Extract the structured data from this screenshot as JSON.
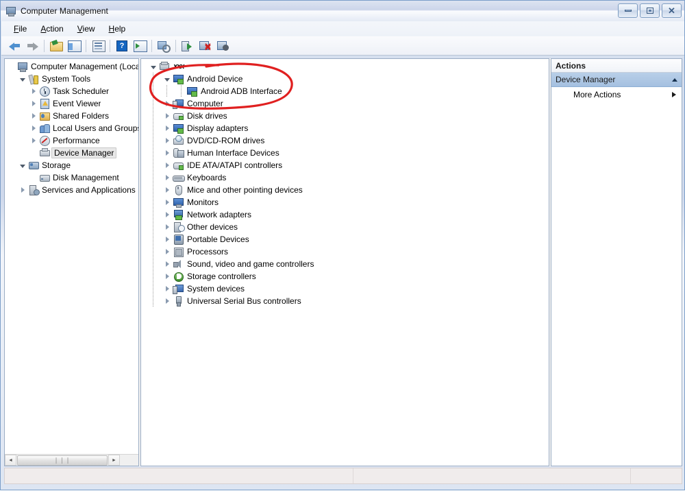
{
  "window": {
    "title": "Computer Management",
    "icon": "computer-management-icon",
    "buttons": {
      "minimize": "Minimize",
      "maximize": "Maximize",
      "close": "Close"
    }
  },
  "menubar": {
    "items": [
      {
        "label": "File",
        "accel": "F"
      },
      {
        "label": "Action",
        "accel": "A"
      },
      {
        "label": "View",
        "accel": "V"
      },
      {
        "label": "Help",
        "accel": "H"
      }
    ]
  },
  "toolbar": {
    "buttons": [
      {
        "name": "back-button",
        "icon": "back-arrow-icon",
        "label": "Back"
      },
      {
        "name": "forward-button",
        "icon": "forward-arrow-icon",
        "label": "Forward"
      },
      {
        "name": "up-one-level-button",
        "icon": "folder-up-icon",
        "label": "Up One Level"
      },
      {
        "name": "show-hide-tree-button",
        "icon": "console-tree-icon",
        "label": "Show/Hide Console Tree"
      },
      {
        "name": "properties-button",
        "icon": "properties-icon",
        "label": "Properties"
      },
      {
        "name": "help-button",
        "icon": "help-question-icon",
        "label": "Help"
      },
      {
        "name": "show-action-pane-button",
        "icon": "action-pane-icon",
        "label": "Show/Hide Action Pane"
      },
      {
        "name": "scan-hardware-button",
        "icon": "scan-hardware-icon",
        "label": "Scan for hardware changes"
      },
      {
        "name": "update-driver-button",
        "icon": "update-driver-icon",
        "label": "Update Driver Software"
      },
      {
        "name": "uninstall-button",
        "icon": "uninstall-device-icon",
        "label": "Uninstall"
      },
      {
        "name": "disable-button",
        "icon": "disable-device-icon",
        "label": "Disable"
      }
    ]
  },
  "console_tree": {
    "nodes": [
      {
        "label": "Computer Management (Local",
        "indent": 0,
        "expander": "none",
        "icon": "computer-management-icon",
        "icon_class": "ic-cm",
        "selected": false
      },
      {
        "label": "System Tools",
        "indent": 1,
        "expander": "open",
        "icon": "system-tools-icon",
        "icon_class": "ic-tools",
        "selected": false
      },
      {
        "label": "Task Scheduler",
        "indent": 2,
        "expander": "closed",
        "icon": "task-scheduler-icon",
        "icon_class": "ic-clock",
        "selected": false
      },
      {
        "label": "Event Viewer",
        "indent": 2,
        "expander": "closed",
        "icon": "event-viewer-icon",
        "icon_class": "ic-event",
        "selected": false
      },
      {
        "label": "Shared Folders",
        "indent": 2,
        "expander": "closed",
        "icon": "shared-folders-icon",
        "icon_class": "ic-shared",
        "selected": false
      },
      {
        "label": "Local Users and Groups",
        "indent": 2,
        "expander": "closed",
        "icon": "local-users-icon",
        "icon_class": "ic-users",
        "selected": false
      },
      {
        "label": "Performance",
        "indent": 2,
        "expander": "closed",
        "icon": "performance-icon",
        "icon_class": "ic-perf",
        "selected": false
      },
      {
        "label": "Device Manager",
        "indent": 2,
        "expander": "none",
        "icon": "device-manager-icon",
        "icon_class": "ic-devmgr",
        "selected": true
      },
      {
        "label": "Storage",
        "indent": 1,
        "expander": "open",
        "icon": "storage-icon",
        "icon_class": "ic-storage",
        "selected": false
      },
      {
        "label": "Disk Management",
        "indent": 2,
        "expander": "none",
        "icon": "disk-management-icon",
        "icon_class": "ic-disk",
        "selected": false
      },
      {
        "label": "Services and Applications",
        "indent": 1,
        "expander": "closed",
        "icon": "services-apps-icon",
        "icon_class": "ic-svc",
        "selected": false
      }
    ],
    "hscrollbar": {
      "left_arrow": "◄",
      "right_arrow": "►",
      "grip": "❘❘❘"
    }
  },
  "device_tree": {
    "nodes": [
      {
        "label": "xxx",
        "indent": 0,
        "expander": "open",
        "icon": "computer-root-icon",
        "icon_class": "ic-root",
        "handwritten": true
      },
      {
        "label": "Android Device",
        "indent": 1,
        "expander": "open",
        "icon": "android-device-icon",
        "icon_class": "ic-mon",
        "handwritten": false
      },
      {
        "label": "Android ADB Interface",
        "indent": 2,
        "expander": "none",
        "icon": "android-adb-icon",
        "icon_class": "ic-mon",
        "handwritten": false
      },
      {
        "label": "Computer",
        "indent": 1,
        "expander": "closed",
        "icon": "computer-icon",
        "icon_class": "ic-comp",
        "handwritten": false
      },
      {
        "label": "Disk drives",
        "indent": 1,
        "expander": "closed",
        "icon": "disk-drives-icon",
        "icon_class": "ic-drive",
        "handwritten": false
      },
      {
        "label": "Display adapters",
        "indent": 1,
        "expander": "closed",
        "icon": "display-adapters-icon",
        "icon_class": "ic-mon",
        "handwritten": false
      },
      {
        "label": "DVD/CD-ROM drives",
        "indent": 1,
        "expander": "closed",
        "icon": "dvd-cdrom-icon",
        "icon_class": "ic-dvd",
        "handwritten": false
      },
      {
        "label": "Human Interface Devices",
        "indent": 1,
        "expander": "closed",
        "icon": "hid-icon",
        "icon_class": "ic-hid",
        "handwritten": false
      },
      {
        "label": "IDE ATA/ATAPI controllers",
        "indent": 1,
        "expander": "closed",
        "icon": "ide-controllers-icon",
        "icon_class": "ic-ide",
        "handwritten": false
      },
      {
        "label": "Keyboards",
        "indent": 1,
        "expander": "closed",
        "icon": "keyboard-icon",
        "icon_class": "ic-kbd",
        "handwritten": false
      },
      {
        "label": "Mice and other pointing devices",
        "indent": 1,
        "expander": "closed",
        "icon": "mouse-icon",
        "icon_class": "ic-mouse",
        "handwritten": false
      },
      {
        "label": "Monitors",
        "indent": 1,
        "expander": "closed",
        "icon": "monitor-icon",
        "icon_class": "ic-monitor",
        "handwritten": false
      },
      {
        "label": "Network adapters",
        "indent": 1,
        "expander": "closed",
        "icon": "network-adapter-icon",
        "icon_class": "ic-net",
        "handwritten": false
      },
      {
        "label": "Other devices",
        "indent": 1,
        "expander": "closed",
        "icon": "other-devices-icon",
        "icon_class": "ic-other",
        "handwritten": false
      },
      {
        "label": "Portable Devices",
        "indent": 1,
        "expander": "closed",
        "icon": "portable-devices-icon",
        "icon_class": "ic-port",
        "handwritten": false
      },
      {
        "label": "Processors",
        "indent": 1,
        "expander": "closed",
        "icon": "processor-icon",
        "icon_class": "ic-cpu",
        "handwritten": false
      },
      {
        "label": "Sound, video and game controllers",
        "indent": 1,
        "expander": "closed",
        "icon": "sound-controllers-icon",
        "icon_class": "ic-snd",
        "handwritten": false
      },
      {
        "label": "Storage controllers",
        "indent": 1,
        "expander": "closed",
        "icon": "storage-controllers-icon",
        "icon_class": "ic-stc",
        "handwritten": false
      },
      {
        "label": "System devices",
        "indent": 1,
        "expander": "closed",
        "icon": "system-devices-icon",
        "icon_class": "ic-sys",
        "handwritten": false
      },
      {
        "label": "Universal Serial Bus controllers",
        "indent": 1,
        "expander": "closed",
        "icon": "usb-controllers-icon",
        "icon_class": "ic-usb",
        "handwritten": false
      }
    ]
  },
  "annotation": {
    "type": "hand-drawn-ellipse",
    "color": "#e02020",
    "encircles": [
      "Android Device",
      "Android ADB Interface"
    ]
  },
  "actions_pane": {
    "title": "Actions",
    "group_label": "Device Manager",
    "group_collapse_icon": "up-caret-icon",
    "items": [
      {
        "label": "More Actions",
        "submenu_icon": "right-caret-icon"
      }
    ]
  },
  "statusbar": {
    "cells": [
      "",
      "",
      ""
    ]
  },
  "colors": {
    "accent": "#a4c0e0",
    "annotation_red": "#e02020",
    "window_border": "#7b9ec9",
    "selection_gray": "#e8e8e8"
  }
}
